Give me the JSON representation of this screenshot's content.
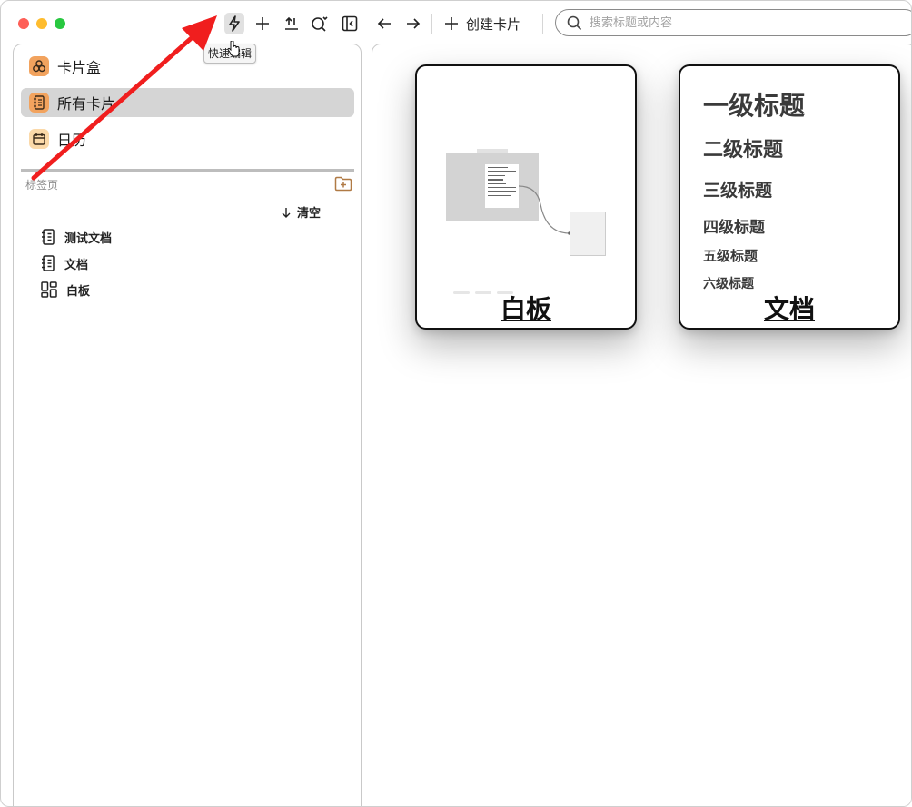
{
  "toolbar": {
    "quick_edit_tooltip": "快速编辑",
    "create_card_label": "创建卡片",
    "search_placeholder": "搜索标题或内容"
  },
  "sidebar": {
    "nav_items": [
      {
        "label": "卡片盒",
        "icon": "card-box-icon"
      },
      {
        "label": "所有卡片",
        "icon": "notebook-icon",
        "selected": true
      },
      {
        "label": "日历",
        "icon": "calendar-icon"
      }
    ],
    "tabs_section_title": "标签页",
    "clear_label": "清空",
    "tabs": [
      {
        "label": "测试文档",
        "icon": "notebook-icon"
      },
      {
        "label": "文档",
        "icon": "notebook-icon"
      },
      {
        "label": "白板",
        "icon": "grid-icon"
      }
    ]
  },
  "cards": [
    {
      "title": "白板",
      "type": "whiteboard"
    },
    {
      "title": "文档",
      "type": "document",
      "headings": [
        "一级标题",
        "二级标题",
        "三级标题",
        "四级标题",
        "五级标题",
        "六级标题"
      ]
    }
  ],
  "colors": {
    "accent_orange": "#f2a35e",
    "selected_bg": "#d5d5d5",
    "annotation_red": "#f01e1e"
  }
}
